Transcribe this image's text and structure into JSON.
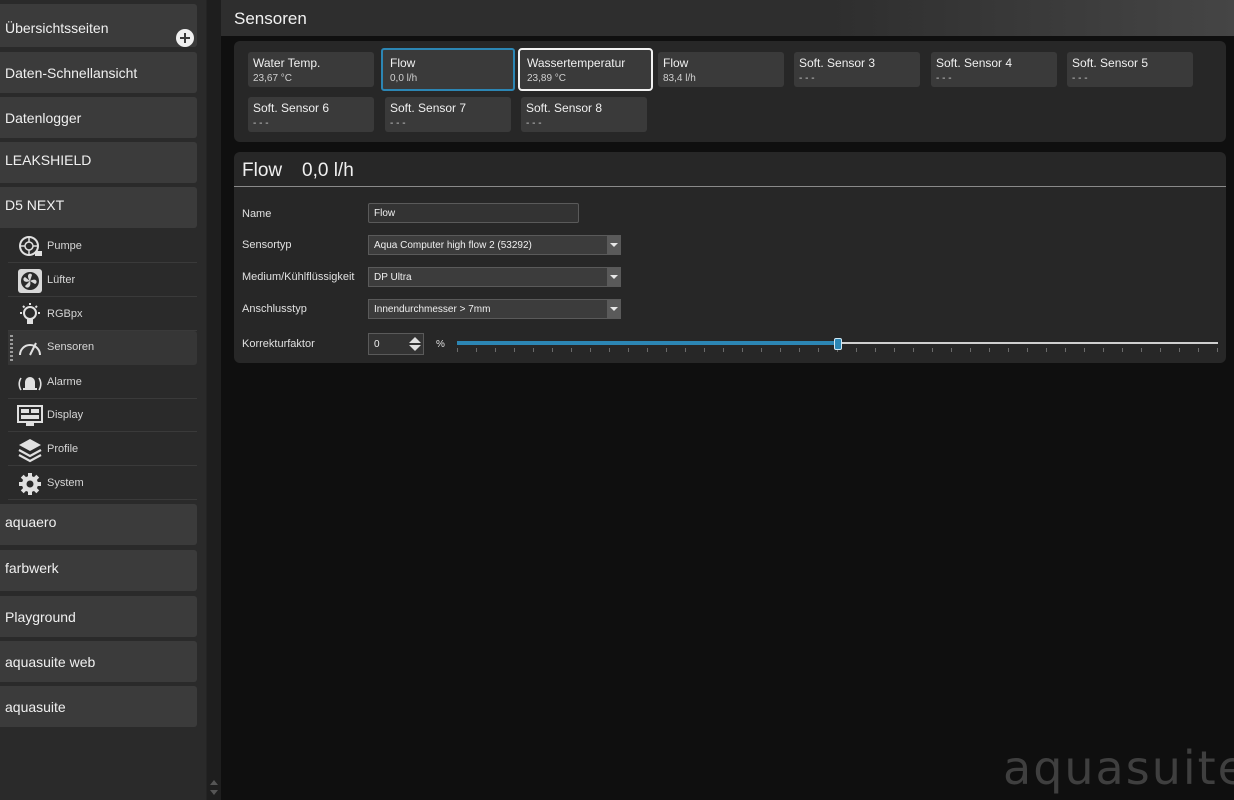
{
  "sidebar": {
    "groups_top": [
      {
        "label": "Übersichtsseiten"
      },
      {
        "label": "Daten-Schnellansicht"
      },
      {
        "label": "Datenlogger"
      },
      {
        "label": "LEAKSHIELD"
      },
      {
        "label": "D5 NEXT"
      }
    ],
    "sub_items": [
      {
        "label": "Pumpe",
        "icon": "pump-icon"
      },
      {
        "label": "Lüfter",
        "icon": "fan-icon"
      },
      {
        "label": "RGBpx",
        "icon": "bulb-icon"
      },
      {
        "label": "Sensoren",
        "icon": "gauge-icon"
      },
      {
        "label": "Alarme",
        "icon": "alarm-icon"
      },
      {
        "label": "Display",
        "icon": "display-icon"
      },
      {
        "label": "Profile",
        "icon": "layers-icon"
      },
      {
        "label": "System",
        "icon": "gear-icon"
      }
    ],
    "groups_bottom": [
      {
        "label": "aquaero"
      },
      {
        "label": "farbwerk"
      },
      {
        "label": "Playground"
      },
      {
        "label": "aquasuite web"
      },
      {
        "label": "aquasuite"
      }
    ]
  },
  "header": {
    "title": "Sensoren"
  },
  "tiles": [
    {
      "name": "Water Temp.",
      "value": "23,67 °C"
    },
    {
      "name": "Flow",
      "value": "0,0 l/h"
    },
    {
      "name": "Wassertemperatur",
      "value": "23,89 °C"
    },
    {
      "name": "Flow",
      "value": "83,4 l/h"
    },
    {
      "name": "Soft. Sensor 3",
      "value": "- - -"
    },
    {
      "name": "Soft. Sensor 4",
      "value": "- - -"
    },
    {
      "name": "Soft. Sensor 5",
      "value": "- - -"
    },
    {
      "name": "Soft. Sensor 6",
      "value": "- - -"
    },
    {
      "name": "Soft. Sensor 7",
      "value": "- - -"
    },
    {
      "name": "Soft. Sensor 8",
      "value": "- - -"
    }
  ],
  "detail": {
    "title": "Flow",
    "value": "0,0 l/h",
    "name_label": "Name",
    "name_value": "Flow",
    "sensortyp_label": "Sensortyp",
    "sensortyp_value": "Aqua Computer high flow 2 (53292)",
    "medium_label": "Medium/Kühlflüssigkeit",
    "medium_value": "DP Ultra",
    "anschluss_label": "Anschlusstyp",
    "anschluss_value": "Innendurchmesser > 7mm",
    "korrektur_label": "Korrekturfaktor",
    "korrektur_value": "0",
    "korrektur_unit": "%",
    "slider_fraction": 0.5
  },
  "colors": {
    "accent": "#2c86b4",
    "panel": "#272727",
    "tile": "#3a3a3a"
  },
  "logo_text": "aquasuite"
}
